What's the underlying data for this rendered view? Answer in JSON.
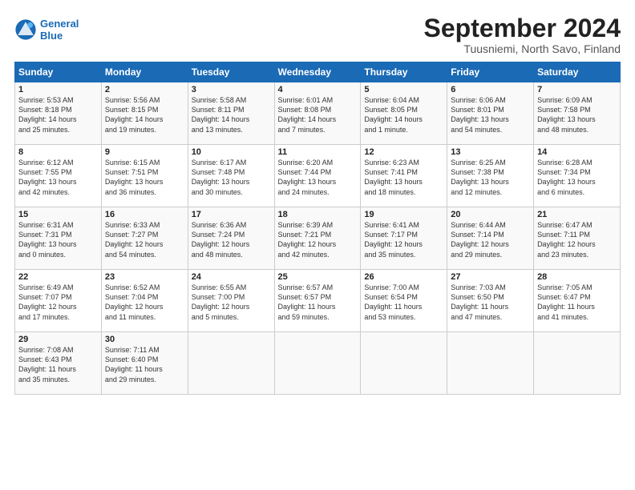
{
  "logo": {
    "line1": "General",
    "line2": "Blue"
  },
  "title": "September 2024",
  "subtitle": "Tuusniemi, North Savo, Finland",
  "days_header": [
    "Sunday",
    "Monday",
    "Tuesday",
    "Wednesday",
    "Thursday",
    "Friday",
    "Saturday"
  ],
  "weeks": [
    [
      {
        "num": "1",
        "info": "Sunrise: 5:53 AM\nSunset: 8:18 PM\nDaylight: 14 hours\nand 25 minutes."
      },
      {
        "num": "2",
        "info": "Sunrise: 5:56 AM\nSunset: 8:15 PM\nDaylight: 14 hours\nand 19 minutes."
      },
      {
        "num": "3",
        "info": "Sunrise: 5:58 AM\nSunset: 8:11 PM\nDaylight: 14 hours\nand 13 minutes."
      },
      {
        "num": "4",
        "info": "Sunrise: 6:01 AM\nSunset: 8:08 PM\nDaylight: 14 hours\nand 7 minutes."
      },
      {
        "num": "5",
        "info": "Sunrise: 6:04 AM\nSunset: 8:05 PM\nDaylight: 14 hours\nand 1 minute."
      },
      {
        "num": "6",
        "info": "Sunrise: 6:06 AM\nSunset: 8:01 PM\nDaylight: 13 hours\nand 54 minutes."
      },
      {
        "num": "7",
        "info": "Sunrise: 6:09 AM\nSunset: 7:58 PM\nDaylight: 13 hours\nand 48 minutes."
      }
    ],
    [
      {
        "num": "8",
        "info": "Sunrise: 6:12 AM\nSunset: 7:55 PM\nDaylight: 13 hours\nand 42 minutes."
      },
      {
        "num": "9",
        "info": "Sunrise: 6:15 AM\nSunset: 7:51 PM\nDaylight: 13 hours\nand 36 minutes."
      },
      {
        "num": "10",
        "info": "Sunrise: 6:17 AM\nSunset: 7:48 PM\nDaylight: 13 hours\nand 30 minutes."
      },
      {
        "num": "11",
        "info": "Sunrise: 6:20 AM\nSunset: 7:44 PM\nDaylight: 13 hours\nand 24 minutes."
      },
      {
        "num": "12",
        "info": "Sunrise: 6:23 AM\nSunset: 7:41 PM\nDaylight: 13 hours\nand 18 minutes."
      },
      {
        "num": "13",
        "info": "Sunrise: 6:25 AM\nSunset: 7:38 PM\nDaylight: 13 hours\nand 12 minutes."
      },
      {
        "num": "14",
        "info": "Sunrise: 6:28 AM\nSunset: 7:34 PM\nDaylight: 13 hours\nand 6 minutes."
      }
    ],
    [
      {
        "num": "15",
        "info": "Sunrise: 6:31 AM\nSunset: 7:31 PM\nDaylight: 13 hours\nand 0 minutes."
      },
      {
        "num": "16",
        "info": "Sunrise: 6:33 AM\nSunset: 7:27 PM\nDaylight: 12 hours\nand 54 minutes."
      },
      {
        "num": "17",
        "info": "Sunrise: 6:36 AM\nSunset: 7:24 PM\nDaylight: 12 hours\nand 48 minutes."
      },
      {
        "num": "18",
        "info": "Sunrise: 6:39 AM\nSunset: 7:21 PM\nDaylight: 12 hours\nand 42 minutes."
      },
      {
        "num": "19",
        "info": "Sunrise: 6:41 AM\nSunset: 7:17 PM\nDaylight: 12 hours\nand 35 minutes."
      },
      {
        "num": "20",
        "info": "Sunrise: 6:44 AM\nSunset: 7:14 PM\nDaylight: 12 hours\nand 29 minutes."
      },
      {
        "num": "21",
        "info": "Sunrise: 6:47 AM\nSunset: 7:11 PM\nDaylight: 12 hours\nand 23 minutes."
      }
    ],
    [
      {
        "num": "22",
        "info": "Sunrise: 6:49 AM\nSunset: 7:07 PM\nDaylight: 12 hours\nand 17 minutes."
      },
      {
        "num": "23",
        "info": "Sunrise: 6:52 AM\nSunset: 7:04 PM\nDaylight: 12 hours\nand 11 minutes."
      },
      {
        "num": "24",
        "info": "Sunrise: 6:55 AM\nSunset: 7:00 PM\nDaylight: 12 hours\nand 5 minutes."
      },
      {
        "num": "25",
        "info": "Sunrise: 6:57 AM\nSunset: 6:57 PM\nDaylight: 11 hours\nand 59 minutes."
      },
      {
        "num": "26",
        "info": "Sunrise: 7:00 AM\nSunset: 6:54 PM\nDaylight: 11 hours\nand 53 minutes."
      },
      {
        "num": "27",
        "info": "Sunrise: 7:03 AM\nSunset: 6:50 PM\nDaylight: 11 hours\nand 47 minutes."
      },
      {
        "num": "28",
        "info": "Sunrise: 7:05 AM\nSunset: 6:47 PM\nDaylight: 11 hours\nand 41 minutes."
      }
    ],
    [
      {
        "num": "29",
        "info": "Sunrise: 7:08 AM\nSunset: 6:43 PM\nDaylight: 11 hours\nand 35 minutes."
      },
      {
        "num": "30",
        "info": "Sunrise: 7:11 AM\nSunset: 6:40 PM\nDaylight: 11 hours\nand 29 minutes."
      },
      {
        "num": "",
        "info": ""
      },
      {
        "num": "",
        "info": ""
      },
      {
        "num": "",
        "info": ""
      },
      {
        "num": "",
        "info": ""
      },
      {
        "num": "",
        "info": ""
      }
    ]
  ]
}
